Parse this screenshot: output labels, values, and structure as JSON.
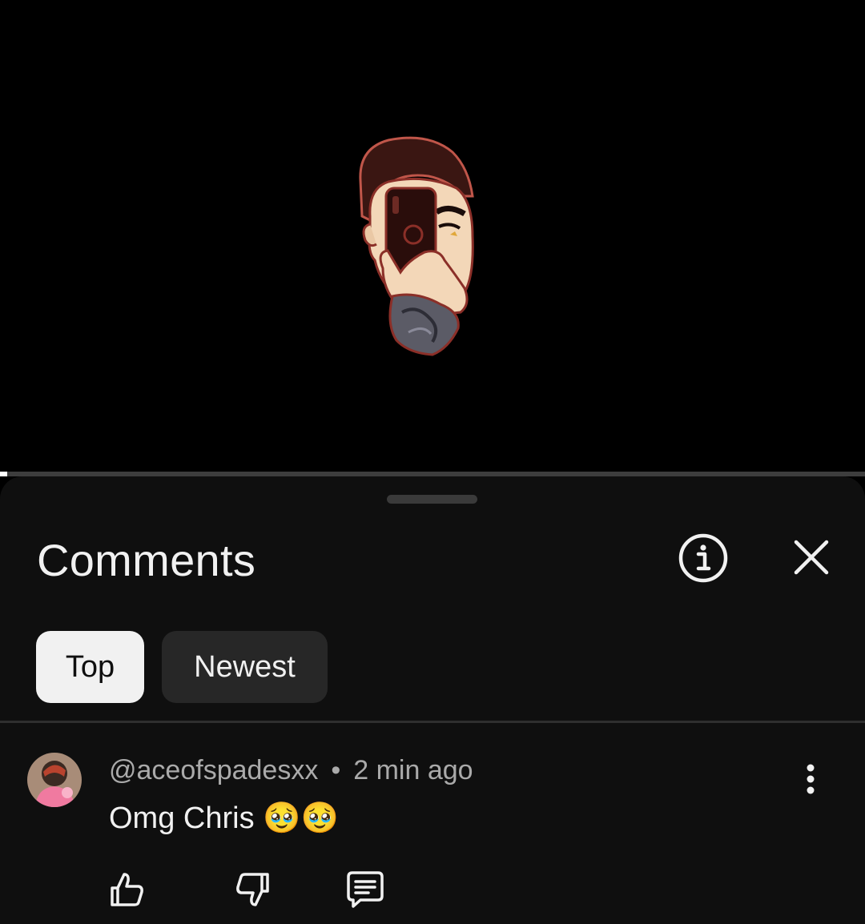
{
  "player": {
    "progress_fraction": 0.008
  },
  "sheet": {
    "title": "Comments",
    "info_icon": "info-circle-icon",
    "close_icon": "close-icon"
  },
  "filters": {
    "top_label": "Top",
    "newest_label": "Newest",
    "selected": "Top"
  },
  "comments": [
    {
      "author": "@aceofspadesxx",
      "separator": "•",
      "time": "2 min ago",
      "text": "Omg Chris 🥹🥹",
      "actions": [
        "thumbs-up-icon",
        "thumbs-down-icon",
        "reply-icon"
      ]
    }
  ],
  "colors": {
    "background": "#000000",
    "sheet": "#0f0f0f",
    "chip_selected": "#f1f1f1",
    "chip_unselected": "#272727",
    "text_primary": "#f1f1f1",
    "text_secondary": "#aaaaaa"
  }
}
